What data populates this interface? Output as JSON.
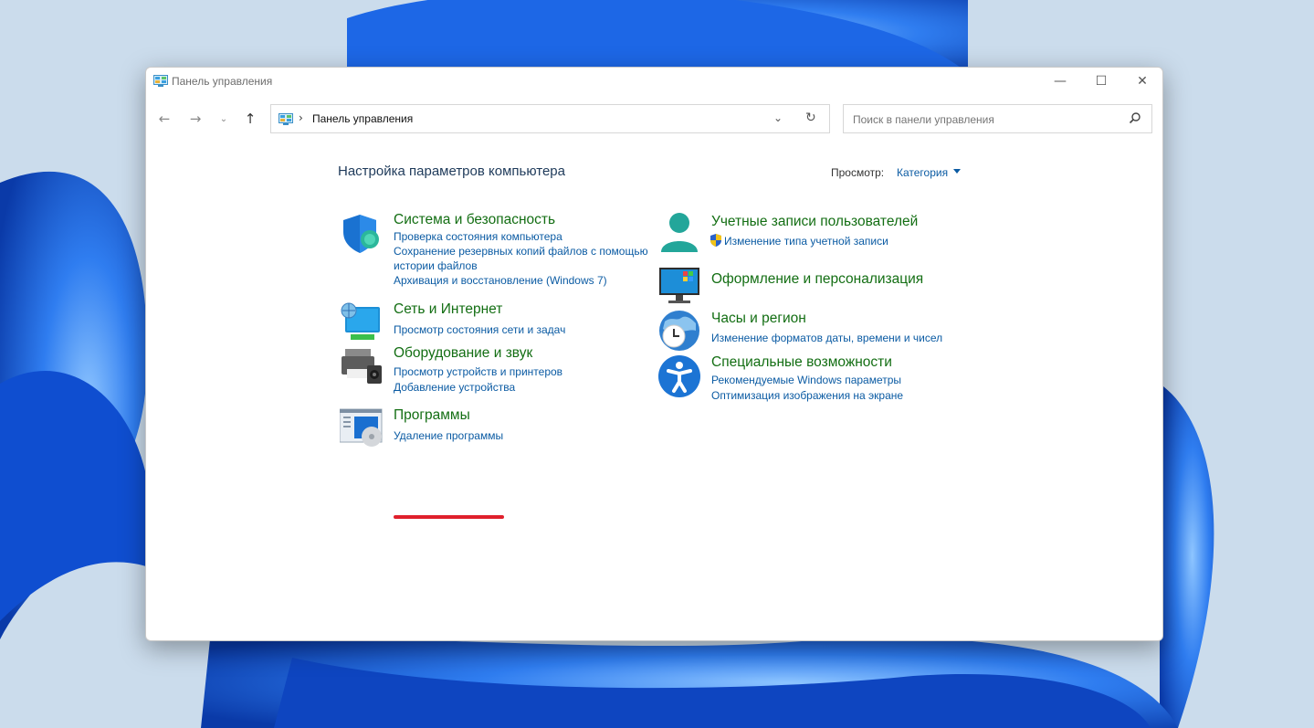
{
  "window": {
    "title": "Панель управления",
    "controls": {
      "minimize": "—",
      "maximize": "☐",
      "close": "✕"
    }
  },
  "nav": {
    "back": "←",
    "forward": "→",
    "recent": "⌄",
    "up": "↑"
  },
  "address": {
    "separator": "›",
    "path": "Панель управления",
    "dropdown": "⌄",
    "refresh": "↻"
  },
  "search": {
    "placeholder": "Поиск в панели управления"
  },
  "main": {
    "heading": "Настройка параметров компьютера",
    "view_label": "Просмотр:",
    "view_value": "Категория"
  },
  "categories_left": [
    {
      "title": "Система и безопасность",
      "icon": "shield-icon",
      "links": [
        "Проверка состояния компьютера",
        "Сохранение резервных копий файлов с помощью",
        "истории файлов",
        "Архивация и восстановление (Windows 7)"
      ]
    },
    {
      "title": "Сеть и Интернет",
      "icon": "network-icon",
      "links": [
        "Просмотр состояния сети и задач"
      ]
    },
    {
      "title": "Оборудование и звук",
      "icon": "printer-icon",
      "links": [
        "Просмотр устройств и принтеров",
        "Добавление устройства"
      ]
    },
    {
      "title": "Программы",
      "icon": "programs-icon",
      "links": [
        "Удаление программы"
      ]
    }
  ],
  "categories_right": [
    {
      "title": "Учетные записи пользователей",
      "icon": "user-icon",
      "links": [
        "Изменение типа учетной записи"
      ]
    },
    {
      "title": "Оформление и персонализация",
      "icon": "monitor-icon",
      "links": []
    },
    {
      "title": "Часы и регион",
      "icon": "clock-globe-icon",
      "links": [
        "Изменение форматов даты, времени и чисел"
      ]
    },
    {
      "title": "Специальные возможности",
      "icon": "accessibility-icon",
      "links": [
        "Рекомендуемые Windows параметры",
        "Оптимизация изображения на экране"
      ]
    }
  ]
}
